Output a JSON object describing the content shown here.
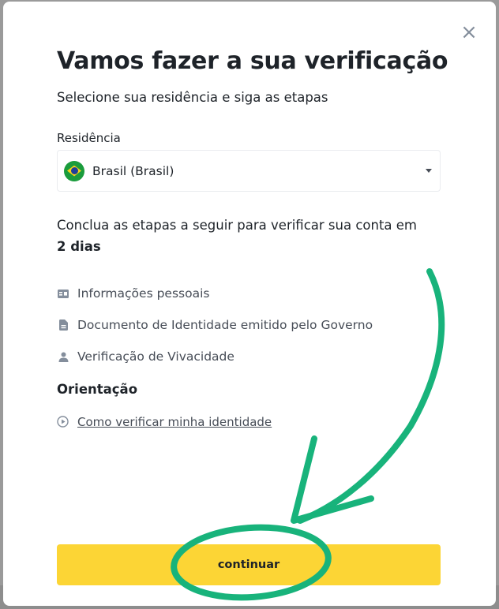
{
  "modal": {
    "title": "Vamos fazer a sua verificação",
    "subtitle": "Selecione sua residência e siga as etapas",
    "close_symbol": "×",
    "residence": {
      "label": "Residência",
      "value": "Brasil (Brasil)",
      "flag_icon": "brazil-flag-icon"
    },
    "conclude": {
      "text": "Conclua as etapas a seguir para verificar sua conta em ",
      "bold": "2 dias"
    },
    "steps": [
      {
        "label": "Informações pessoais",
        "icon": "id-card-icon"
      },
      {
        "label": "Documento de Identidade emitido pelo Governo",
        "icon": "document-icon"
      },
      {
        "label": "Verificação de Vivacidade",
        "icon": "person-icon"
      }
    ],
    "guidance": {
      "heading": "Orientação",
      "link": "Como verificar minha identidade",
      "icon": "play-circle-icon"
    },
    "continue_label": "continuar"
  },
  "colors": {
    "accent_button": "#fcd535",
    "annotation_green": "#18b37b"
  }
}
